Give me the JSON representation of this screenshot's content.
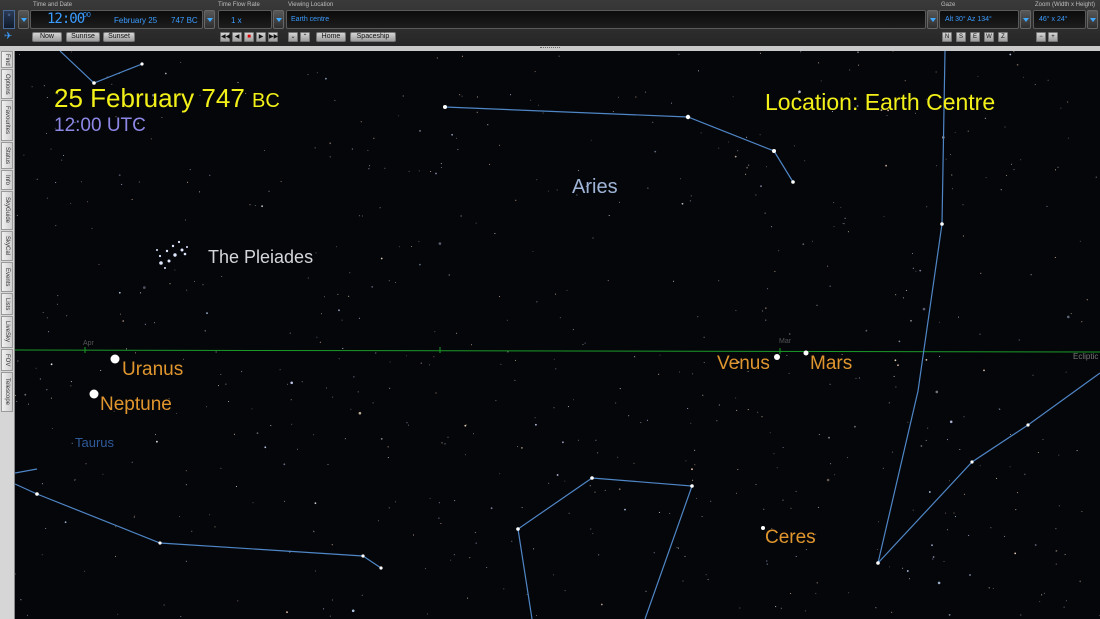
{
  "toolbar": {
    "time_and_date": {
      "header": "Time and Date",
      "time_main": "12:00",
      "time_seconds": "00",
      "date": "February 25",
      "year": "747 BC",
      "buttons": [
        "Now",
        "Sunrise",
        "Sunset"
      ]
    },
    "time_flow": {
      "header": "Time Flow Rate",
      "value": "1 x",
      "playback_icons": [
        "skip-back-icon",
        "step-back-icon",
        "stop-icon",
        "play-icon",
        "skip-forward-icon"
      ]
    },
    "viewing_location": {
      "header": "Viewing Location",
      "value": "Earth centre",
      "buttons": [
        "Home",
        "Spaceship"
      ]
    },
    "gaze": {
      "header": "Gaze",
      "value": "Alt 30° Az 134°",
      "directions": [
        "N",
        "S",
        "E",
        "W",
        "Z"
      ]
    },
    "zoom": {
      "header": "Zoom (Width x Height)",
      "value": "46° x 24°",
      "buttons": [
        "−",
        "+"
      ]
    }
  },
  "side_tabs": [
    "Find",
    "Options",
    "Favourites",
    "Status",
    "Info",
    "SkyGuide",
    "SkyCal",
    "Events",
    "Lists",
    "LiveSky",
    "FOV",
    "Telescope"
  ],
  "overlay": {
    "date_main": "25 February 747",
    "date_era": "BC",
    "time": "12:00 UTC",
    "location": "Location: Earth Centre"
  },
  "sky_labels": {
    "aries": "Aries",
    "pleiades": "The Pleiades",
    "uranus": "Uranus",
    "neptune": "Neptune",
    "venus": "Venus",
    "mars": "Mars",
    "ceres": "Ceres",
    "taurus": "Taurus",
    "ecliptic": "Ecliptic",
    "apr": "Apr",
    "mar": "Mar"
  },
  "colors": {
    "overlay_text": "#f2f018",
    "planet_label": "#e0962e",
    "constellation_line": "#4f86c6",
    "ecliptic_line": "#1a9a28",
    "toolbar_value": "#3b9cff"
  }
}
